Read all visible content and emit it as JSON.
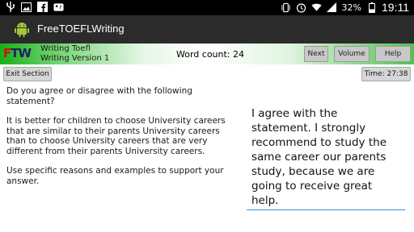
{
  "status_bar": {
    "time": "19:11",
    "battery": "32%"
  },
  "action_bar": {
    "title": "FreeTOEFLWriting"
  },
  "header": {
    "logo": "FTW",
    "subtitle_line1": "Writing Toefl",
    "subtitle_line2": "Writing Version 1",
    "word_count": "Word count: 24",
    "buttons": {
      "next": "Next",
      "volume": "Volume",
      "help": "Help"
    }
  },
  "toolbar": {
    "exit_section": "Exit Section",
    "timer": "Time: 27:38"
  },
  "prompt": {
    "question": "Do you agree or disagree with the following statement?",
    "statement": "It is better for children to choose University careers that are similar to their parents University careers than to choose University careers that are very different from their parents University careers.",
    "instructions": "Use specific reasons and examples to support your answer."
  },
  "answer": {
    "text": "I agree with the statement. I strongly recommend to study the same career our parents study, because we are going to receive great help."
  },
  "colors": {
    "header_green": "#19b019",
    "focus_blue": "#3a8fd6"
  }
}
